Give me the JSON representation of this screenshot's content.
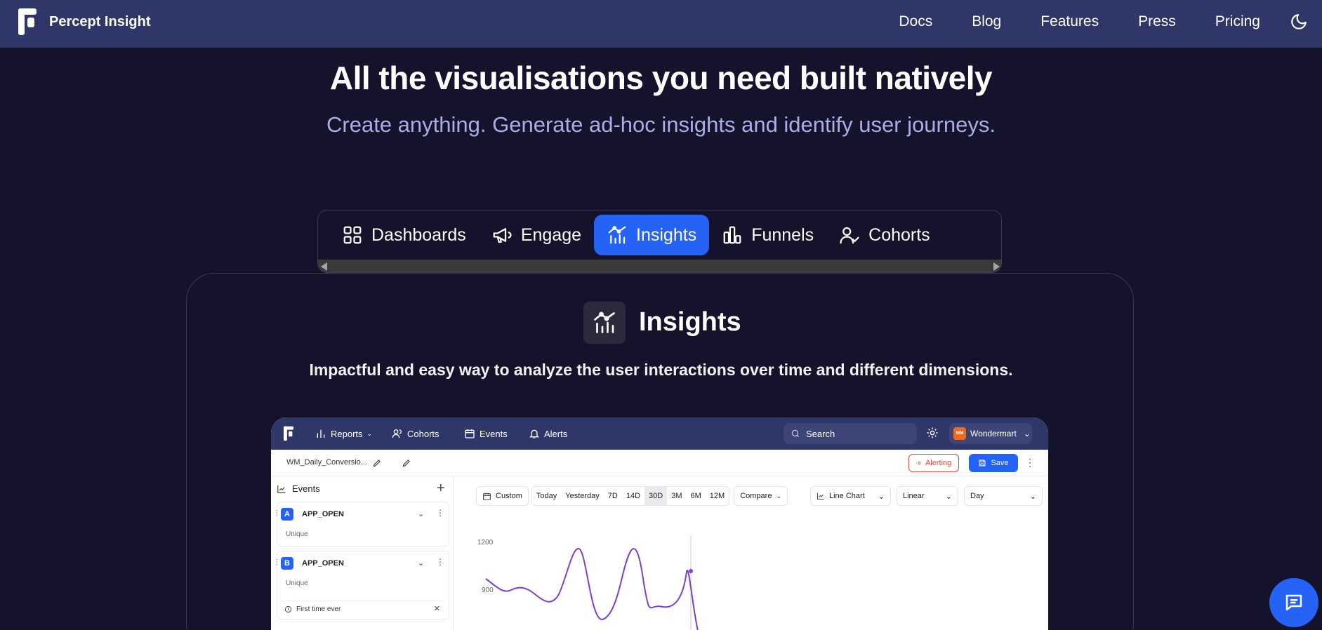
{
  "nav": {
    "brand": "Percept Insight",
    "links": [
      "Docs",
      "Blog",
      "Features",
      "Press",
      "Pricing"
    ]
  },
  "hero": {
    "title": "All the visualisations you need built natively",
    "subtitle": "Create anything. Generate ad-hoc insights and identify user journeys."
  },
  "tabs": [
    "Dashboards",
    "Engage",
    "Insights",
    "Funnels",
    "Cohorts"
  ],
  "active_tab": "Insights",
  "feature": {
    "title": "Insights",
    "description": "Impactful and easy way to analyze the user interactions over time and different dimensions."
  },
  "mock": {
    "nav": {
      "reports": "Reports",
      "cohorts": "Cohorts",
      "events": "Events",
      "alerts": "Alerts",
      "search": "Search",
      "org": "Wondermart",
      "org_badge": "WM"
    },
    "report_name": "WM_Daily_Conversio...",
    "alerting": "Alerting",
    "save": "Save",
    "events_header": "Events",
    "events": [
      {
        "letter": "A",
        "name": "APP_OPEN",
        "sub": "Unique"
      },
      {
        "letter": "B",
        "name": "APP_OPEN",
        "sub": "Unique",
        "filter": "First time ever"
      }
    ],
    "custom": "Custom",
    "ranges": [
      "Today",
      "Yesterday",
      "7D",
      "14D",
      "30D",
      "3M",
      "6M",
      "12M"
    ],
    "active_range": "30D",
    "compare": "Compare",
    "chart_type": "Line Chart",
    "scale": "Linear",
    "interval": "Day",
    "y_ticks": [
      "1200",
      "900"
    ]
  },
  "colors": {
    "nav": "#2f3768",
    "bg": "#14132b",
    "accent": "#2563f6",
    "line": "#7b3fd3"
  }
}
